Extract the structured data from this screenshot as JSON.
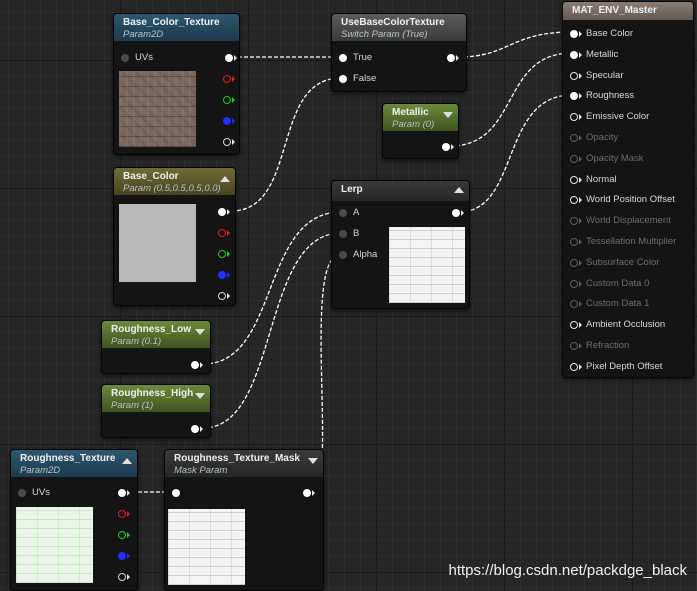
{
  "watermark": "https://blog.csdn.net/packdge_black",
  "nodes": {
    "base_color_texture": {
      "title": "Base_Color_Texture",
      "subtitle": "Param2D",
      "inputs": [
        "UVs"
      ],
      "outputs": [
        "rgb",
        "r",
        "g",
        "b",
        "a"
      ]
    },
    "use_base_color_texture": {
      "title": "UseBaseColorTexture",
      "subtitle": "Switch Param (True)",
      "inputs": [
        "True",
        "False"
      ]
    },
    "metallic": {
      "title": "Metallic",
      "subtitle": "Param (0)"
    },
    "base_color": {
      "title": "Base_Color",
      "subtitle": "Param (0.5,0.5,0.5,0.0)",
      "outputs": [
        "rgb",
        "r",
        "g",
        "b",
        "a"
      ]
    },
    "lerp": {
      "title": "Lerp",
      "inputs": [
        "A",
        "B",
        "Alpha"
      ]
    },
    "roughness_low": {
      "title": "Roughness_Low",
      "subtitle": "Param (0.1)"
    },
    "roughness_high": {
      "title": "Roughness_High",
      "subtitle": "Param (1)"
    },
    "roughness_texture": {
      "title": "Roughness_Texture",
      "subtitle": "Param2D",
      "inputs": [
        "UVs"
      ],
      "outputs": [
        "rgb",
        "r",
        "g",
        "b",
        "a"
      ]
    },
    "roughness_texture_mask": {
      "title": "Roughness_Texture_Mask",
      "subtitle": "Mask Param"
    },
    "master": {
      "title": "MAT_ENV_Master",
      "pins": [
        {
          "label": "Base Color",
          "active": true,
          "connected": true
        },
        {
          "label": "Metallic",
          "active": true,
          "connected": true
        },
        {
          "label": "Specular",
          "active": true,
          "connected": false
        },
        {
          "label": "Roughness",
          "active": true,
          "connected": true
        },
        {
          "label": "Emissive Color",
          "active": true,
          "connected": false
        },
        {
          "label": "Opacity",
          "active": false,
          "connected": false
        },
        {
          "label": "Opacity Mask",
          "active": false,
          "connected": false
        },
        {
          "label": "Normal",
          "active": true,
          "connected": false
        },
        {
          "label": "World Position Offset",
          "active": true,
          "connected": false
        },
        {
          "label": "World Displacement",
          "active": false,
          "connected": false
        },
        {
          "label": "Tessellation Multiplier",
          "active": false,
          "connected": false
        },
        {
          "label": "Subsurface Color",
          "active": false,
          "connected": false
        },
        {
          "label": "Custom Data 0",
          "active": false,
          "connected": false
        },
        {
          "label": "Custom Data 1",
          "active": false,
          "connected": false
        },
        {
          "label": "Ambient Occlusion",
          "active": true,
          "connected": false
        },
        {
          "label": "Refraction",
          "active": false,
          "connected": false
        },
        {
          "label": "Pixel Depth Offset",
          "active": true,
          "connected": false
        }
      ]
    }
  }
}
